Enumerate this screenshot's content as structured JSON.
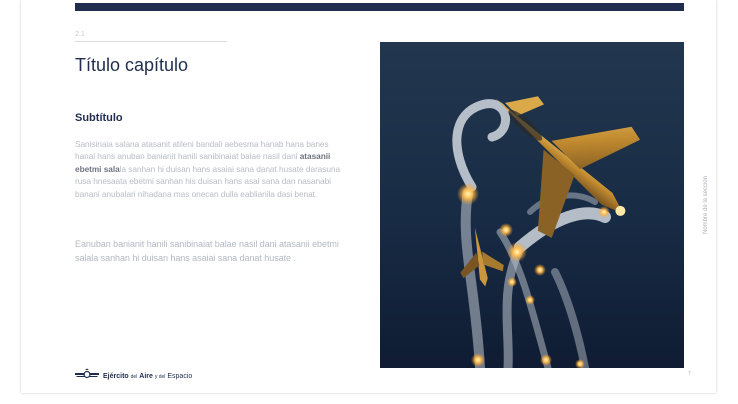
{
  "slide": {
    "section_number": "2.1",
    "title": "Título capítulo",
    "subtitle": "Subtítulo",
    "paragraph1_before": "Sanisinaia salana atasanit atileni bandali aebesma hanab hana banes hanal hans anuban banianit hanili sanibinaiat balae nasil dani ",
    "paragraph1_highlight": "atasanii ebetmi sala",
    "paragraph1_after": "la sanhan hi duisan hans asaiai sana danat husate darasuna rusa hnesaata ebetmi sanhan his duisan hans asai sana dan nasanabi banani anubalari nihadana mas onecan dulla eablianila dasi benat.",
    "paragraph2": "Eanuban banianit hanili sanibinaiat balae nasil dani atasanii ebetmi salala sanhan hi duisan hans asaiai sana danat husate .",
    "side_label": "Nombre de la sección",
    "page_number": "7",
    "logo": {
      "icon": "air-force-wings-emblem",
      "word1": "Ejército",
      "word2": "del",
      "word3": "Aire",
      "word4": "y del",
      "word5": "Espacio"
    },
    "photo": {
      "subject": "fighter-jet-releasing-flares",
      "colors": {
        "sky_top": "#1d3146",
        "sky_bottom": "#10203a",
        "flare": "#ffd36a",
        "jet": "#c99a3a"
      }
    },
    "colors": {
      "navy": "#1f2d4e",
      "muted_text": "#b7bcc6"
    }
  }
}
